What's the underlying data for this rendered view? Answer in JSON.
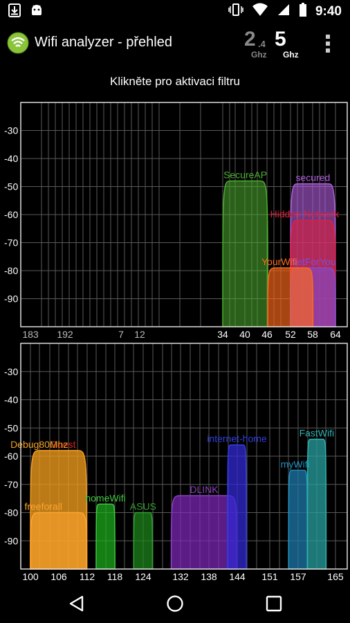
{
  "status_bar": {
    "time": "9:40",
    "left_icons": [
      "download-icon",
      "android-icon"
    ],
    "right_icons": [
      "vibrate-icon",
      "wifi-icon",
      "signal-icon",
      "battery-icon"
    ]
  },
  "app_bar": {
    "title": "Wifi analyzer - přehled",
    "band_24": {
      "main": "2",
      "decimal": ".4",
      "unit": "Ghz",
      "active": false
    },
    "band_5": {
      "main": "5",
      "unit": "Ghz",
      "active": true
    }
  },
  "filter_hint": "Klikněte pro aktivaci filtru",
  "chart_data": [
    {
      "type": "area",
      "y_ticks": [
        "-30",
        "-40",
        "-50",
        "-60",
        "-70",
        "-80",
        "-90"
      ],
      "ylim": [
        -100,
        -20
      ],
      "x_ticks": [
        "183",
        "192",
        "7",
        "12",
        "34",
        "40",
        "46",
        "52",
        "58",
        "64"
      ],
      "series": [
        {
          "name": "SecureAP",
          "color": "#4caf2e",
          "fill": "rgba(76,175,46,0.55)",
          "channel": 38,
          "signal": -48
        },
        {
          "name": "secured",
          "color": "#b35ee0",
          "fill": "rgba(179,94,224,0.6)",
          "channel": 58,
          "signal": -49
        },
        {
          "name": "Hidden Network",
          "color": "#e0203a",
          "fill": "rgba(224,32,58,0.6)",
          "channel": 58,
          "signal": -62
        },
        {
          "name": "NetForYou",
          "color": "#7a4fd8",
          "fill": "rgba(122,79,216,0.55)",
          "channel": 58,
          "signal": -79
        },
        {
          "name": "YourWifi",
          "color": "#ff6a1a",
          "fill": "rgba(255,106,26,0.65)",
          "channel": 52,
          "signal": -79
        }
      ]
    },
    {
      "type": "area",
      "y_ticks": [
        "-30",
        "-40",
        "-50",
        "-60",
        "-70",
        "-80",
        "-90"
      ],
      "ylim": [
        -100,
        -20
      ],
      "x_ticks": [
        "100",
        "106",
        "112",
        "118",
        "124",
        "132",
        "138",
        "144",
        "151",
        "157",
        "165"
      ],
      "series": [
        {
          "name": "Guest",
          "color": "#e02020",
          "fill": "rgba(224,140,20,0.55)",
          "channel": 106,
          "signal": -58
        },
        {
          "name": "Debug80Mhz",
          "color": "#f0a020",
          "fill": "rgba(240,160,32,0.55)",
          "channel": 106,
          "signal": -58
        },
        {
          "name": "freeforall",
          "color": "#ffa530",
          "fill": "rgba(255,165,48,0.6)",
          "channel": 104,
          "signal": -80
        },
        {
          "name": "homeWifi",
          "color": "#40c840",
          "fill": "rgba(30,180,30,0.7)",
          "channel": 116,
          "signal": -77
        },
        {
          "name": "ASUS",
          "color": "#30a030",
          "fill": "rgba(30,140,30,0.7)",
          "channel": 124,
          "signal": -80
        },
        {
          "name": "DLINK",
          "color": "#8a40c0",
          "fill": "rgba(130,40,190,0.7)",
          "channel": 136,
          "signal": -74
        },
        {
          "name": "internet-home",
          "color": "#3040e0",
          "fill": "rgba(50,40,210,0.75)",
          "channel": 144,
          "signal": -56
        },
        {
          "name": "myWifi",
          "color": "#2090c0",
          "fill": "rgba(30,120,170,0.75)",
          "channel": 157,
          "signal": -65
        },
        {
          "name": "FastWifi",
          "color": "#30b0b0",
          "fill": "rgba(40,160,160,0.75)",
          "channel": 161,
          "signal": -54
        }
      ]
    }
  ],
  "nav_bar": {
    "buttons": [
      "back-icon",
      "home-icon",
      "recents-icon"
    ]
  }
}
